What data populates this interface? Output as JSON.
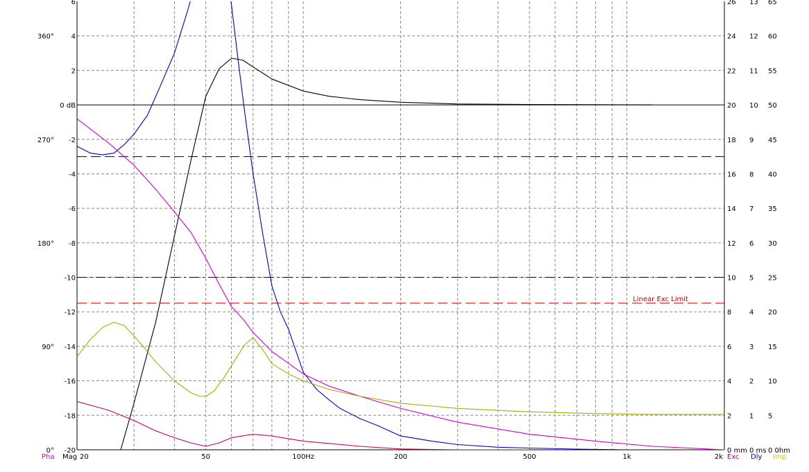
{
  "chart_data": {
    "type": "line",
    "x_scale": "log",
    "xlim": [
      20,
      2000
    ],
    "x_ticks_major": [
      {
        "v": 20,
        "label": "20"
      },
      {
        "v": 50,
        "label": "50"
      },
      {
        "v": 100,
        "label": "100Hz"
      },
      {
        "v": 200,
        "label": "200"
      },
      {
        "v": 500,
        "label": "500"
      },
      {
        "v": 1000,
        "label": "1k"
      },
      {
        "v": 2000,
        "label": "2k"
      }
    ],
    "x_grid": [
      30,
      40,
      60,
      70,
      80,
      90,
      300,
      400,
      600,
      700,
      800,
      900
    ],
    "ylim": [
      -20,
      6
    ],
    "y_ticks": [
      {
        "v": 6,
        "label": "6"
      },
      {
        "v": 4,
        "label": "4"
      },
      {
        "v": 2,
        "label": "2"
      },
      {
        "v": 0,
        "label": "0 dB"
      },
      {
        "v": -2,
        "label": "-2"
      },
      {
        "v": -4,
        "label": "-4"
      },
      {
        "v": -6,
        "label": "-6"
      },
      {
        "v": -8,
        "label": "-8"
      },
      {
        "v": -10,
        "label": "-10"
      },
      {
        "v": -12,
        "label": "-12"
      },
      {
        "v": -14,
        "label": "-14"
      },
      {
        "v": -16,
        "label": "-16"
      },
      {
        "v": -18,
        "label": "-18"
      },
      {
        "v": -20,
        "label": "-20"
      }
    ],
    "phase_ticks": [
      {
        "v": 4,
        "label": "360°"
      },
      {
        "v": -2,
        "label": "270°"
      },
      {
        "v": -8,
        "label": "180°"
      },
      {
        "v": -14,
        "label": "90°"
      },
      {
        "v": -20,
        "label": "0°"
      }
    ],
    "right_axis_1": [
      {
        "v": 6,
        "label": "26"
      },
      {
        "v": 4,
        "label": "24"
      },
      {
        "v": 2,
        "label": "22"
      },
      {
        "v": 0,
        "label": "20"
      },
      {
        "v": -2,
        "label": "18"
      },
      {
        "v": -4,
        "label": "16"
      },
      {
        "v": -6,
        "label": "14"
      },
      {
        "v": -8,
        "label": "12"
      },
      {
        "v": -10,
        "label": "10"
      },
      {
        "v": -12,
        "label": "8"
      },
      {
        "v": -14,
        "label": "6"
      },
      {
        "v": -16,
        "label": "4"
      },
      {
        "v": -18,
        "label": "2"
      },
      {
        "v": -20,
        "label": "0 mm"
      }
    ],
    "right_axis_2": [
      {
        "v": 6,
        "label": "13"
      },
      {
        "v": 4,
        "label": "12"
      },
      {
        "v": 2,
        "label": "11"
      },
      {
        "v": 0,
        "label": "10"
      },
      {
        "v": -2,
        "label": "9"
      },
      {
        "v": -4,
        "label": "8"
      },
      {
        "v": -6,
        "label": "7"
      },
      {
        "v": -8,
        "label": "6"
      },
      {
        "v": -10,
        "label": "5"
      },
      {
        "v": -12,
        "label": "4"
      },
      {
        "v": -14,
        "label": "3"
      },
      {
        "v": -16,
        "label": "2"
      },
      {
        "v": -18,
        "label": "1"
      },
      {
        "v": -20,
        "label": "0 ms"
      }
    ],
    "right_axis_3": [
      {
        "v": 6,
        "label": "65"
      },
      {
        "v": 4,
        "label": "60"
      },
      {
        "v": 2,
        "label": "55"
      },
      {
        "v": 0,
        "label": "50"
      },
      {
        "v": -2,
        "label": "45"
      },
      {
        "v": -4,
        "label": "40"
      },
      {
        "v": -6,
        "label": "35"
      },
      {
        "v": -8,
        "label": "30"
      },
      {
        "v": -10,
        "label": "25"
      },
      {
        "v": -12,
        "label": "20"
      },
      {
        "v": -14,
        "label": "15"
      },
      {
        "v": -16,
        "label": "10"
      },
      {
        "v": -18,
        "label": "5"
      },
      {
        "v": -20,
        "label": "0 0hm"
      }
    ],
    "bottom_left_labels": {
      "pha": "Pha",
      "mag": "Mag"
    },
    "bottom_right_labels": {
      "exc": "Exc",
      "dly": "Dly",
      "imp": "Imp"
    },
    "reference_lines": [
      {
        "y": 0,
        "color": "#000000",
        "style": "solid"
      },
      {
        "y": -3,
        "color": "#000000",
        "style": "dashed"
      },
      {
        "y": -10,
        "color": "#000000",
        "style": "dashdot"
      },
      {
        "y": -11.5,
        "color": "#cc0000",
        "style": "dashed",
        "label": "Linear Exc Limit"
      }
    ],
    "series": [
      {
        "color": "#000000",
        "x": [
          27.3,
          30,
          35,
          40,
          45,
          50,
          55,
          60,
          65,
          70,
          80,
          100,
          120,
          150,
          200,
          300,
          500,
          800,
          1200
        ],
        "y": [
          -20,
          -17.3,
          -12.6,
          -7.6,
          -3.2,
          0.5,
          2.1,
          2.7,
          2.6,
          2.2,
          1.5,
          0.8,
          0.5,
          0.3,
          0.15,
          0.05,
          0.02,
          0.01,
          0
        ]
      },
      {
        "color": "#0000cc",
        "x": [
          20,
          22,
          24,
          26,
          28,
          30,
          33,
          36,
          40,
          44,
          48,
          50,
          54,
          58,
          60,
          63,
          66,
          70,
          75,
          80,
          85,
          90,
          100,
          110,
          120,
          130,
          150,
          170,
          200,
          250,
          300,
          400,
          500,
          700,
          1000
        ],
        "y": [
          -2.4,
          -2.8,
          -2.9,
          -2.8,
          -2.3,
          -1.7,
          -0.6,
          1.0,
          3.0,
          5.5,
          8,
          9,
          9,
          7.5,
          5.8,
          2.5,
          -0.5,
          -4,
          -7.5,
          -10.5,
          -12,
          -13,
          -15.5,
          -16.5,
          -17.1,
          -17.6,
          -18.2,
          -18.6,
          -19.2,
          -19.5,
          -19.7,
          -19.85,
          -19.9,
          -19.96,
          -20
        ]
      },
      {
        "color": "#cc00cc",
        "x": [
          20,
          25,
          30,
          35,
          40,
          45,
          50,
          55,
          60,
          65,
          70,
          80,
          100,
          120,
          150,
          200,
          300,
          500,
          800,
          1200,
          2000
        ],
        "y": [
          -0.8,
          -2.2,
          -3.5,
          -4.9,
          -6.2,
          -7.4,
          -8.9,
          -10.4,
          -11.7,
          -12.4,
          -13.2,
          -14.3,
          -15.6,
          -16.3,
          -16.9,
          -17.6,
          -18.4,
          -19.1,
          -19.5,
          -19.8,
          -20
        ]
      },
      {
        "color": "#aaaa00",
        "x": [
          20,
          22,
          24,
          26,
          28,
          30,
          32,
          35,
          40,
          45,
          48,
          50,
          53,
          57,
          62,
          66,
          70,
          75,
          80,
          90,
          100,
          120,
          150,
          200,
          300,
          500,
          800,
          1200,
          2000
        ],
        "y": [
          -14.6,
          -13.6,
          -12.9,
          -12.6,
          -12.8,
          -13.4,
          -14,
          -14.9,
          -16,
          -16.7,
          -16.9,
          -16.9,
          -16.6,
          -15.8,
          -14.7,
          -13.9,
          -13.5,
          -14.2,
          -15,
          -15.6,
          -16,
          -16.5,
          -16.9,
          -17.3,
          -17.6,
          -17.8,
          -17.9,
          -17.95,
          -17.95
        ]
      },
      {
        "color": "#cc0066",
        "x": [
          20,
          25,
          30,
          35,
          40,
          45,
          50,
          55,
          60,
          70,
          80,
          100,
          150,
          200,
          300,
          500
        ],
        "y": [
          -17.2,
          -17.7,
          -18.3,
          -18.9,
          -19.3,
          -19.6,
          -19.8,
          -19.6,
          -19.3,
          -19.1,
          -19.2,
          -19.5,
          -19.8,
          -19.95,
          -20,
          -20
        ]
      }
    ]
  }
}
